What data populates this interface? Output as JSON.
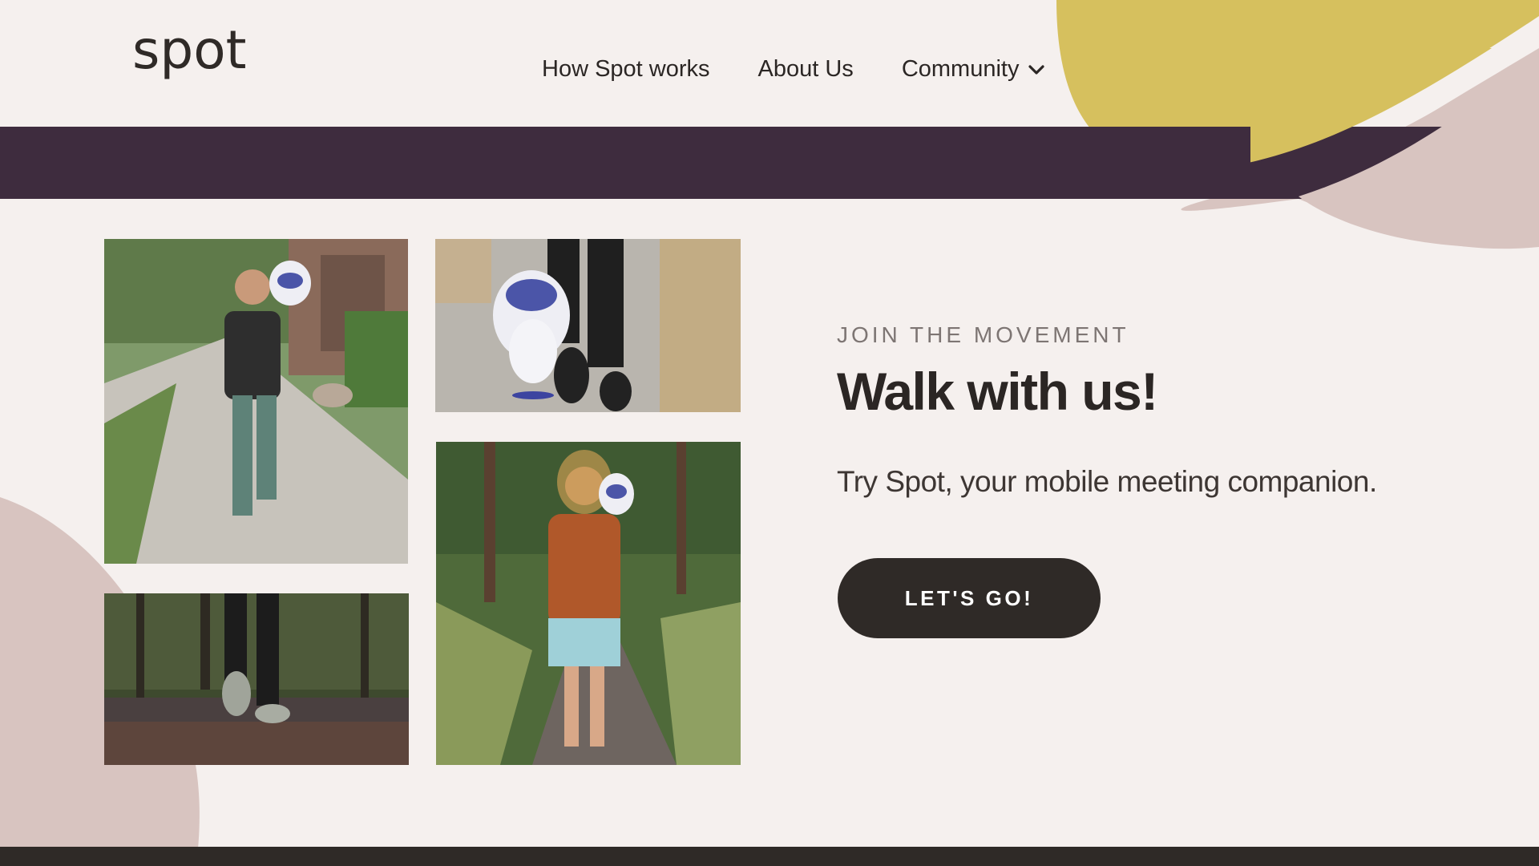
{
  "brand": {
    "name": "spot"
  },
  "nav": {
    "items": [
      {
        "label": "How Spot works"
      },
      {
        "label": "About Us"
      },
      {
        "label": "Community"
      }
    ]
  },
  "hero": {
    "eyebrow": "JOIN THE MOVEMENT",
    "headline": "Walk with us!",
    "subline": "Try Spot, your mobile meeting companion.",
    "button_label": "LET'S GO!"
  },
  "photos": [
    {
      "name": "man-walking-with-spot-photo"
    },
    {
      "name": "spot-mascot-walking-feet-photo"
    },
    {
      "name": "man-in-forest-with-spot-photo"
    },
    {
      "name": "walking-feet-road-photo"
    }
  ],
  "colors": {
    "background": "#f5f0ee",
    "band": "#3e2c3e",
    "mustard": "#d6c05e",
    "blush": "#d8c4c0",
    "dark": "#2f2a27"
  }
}
